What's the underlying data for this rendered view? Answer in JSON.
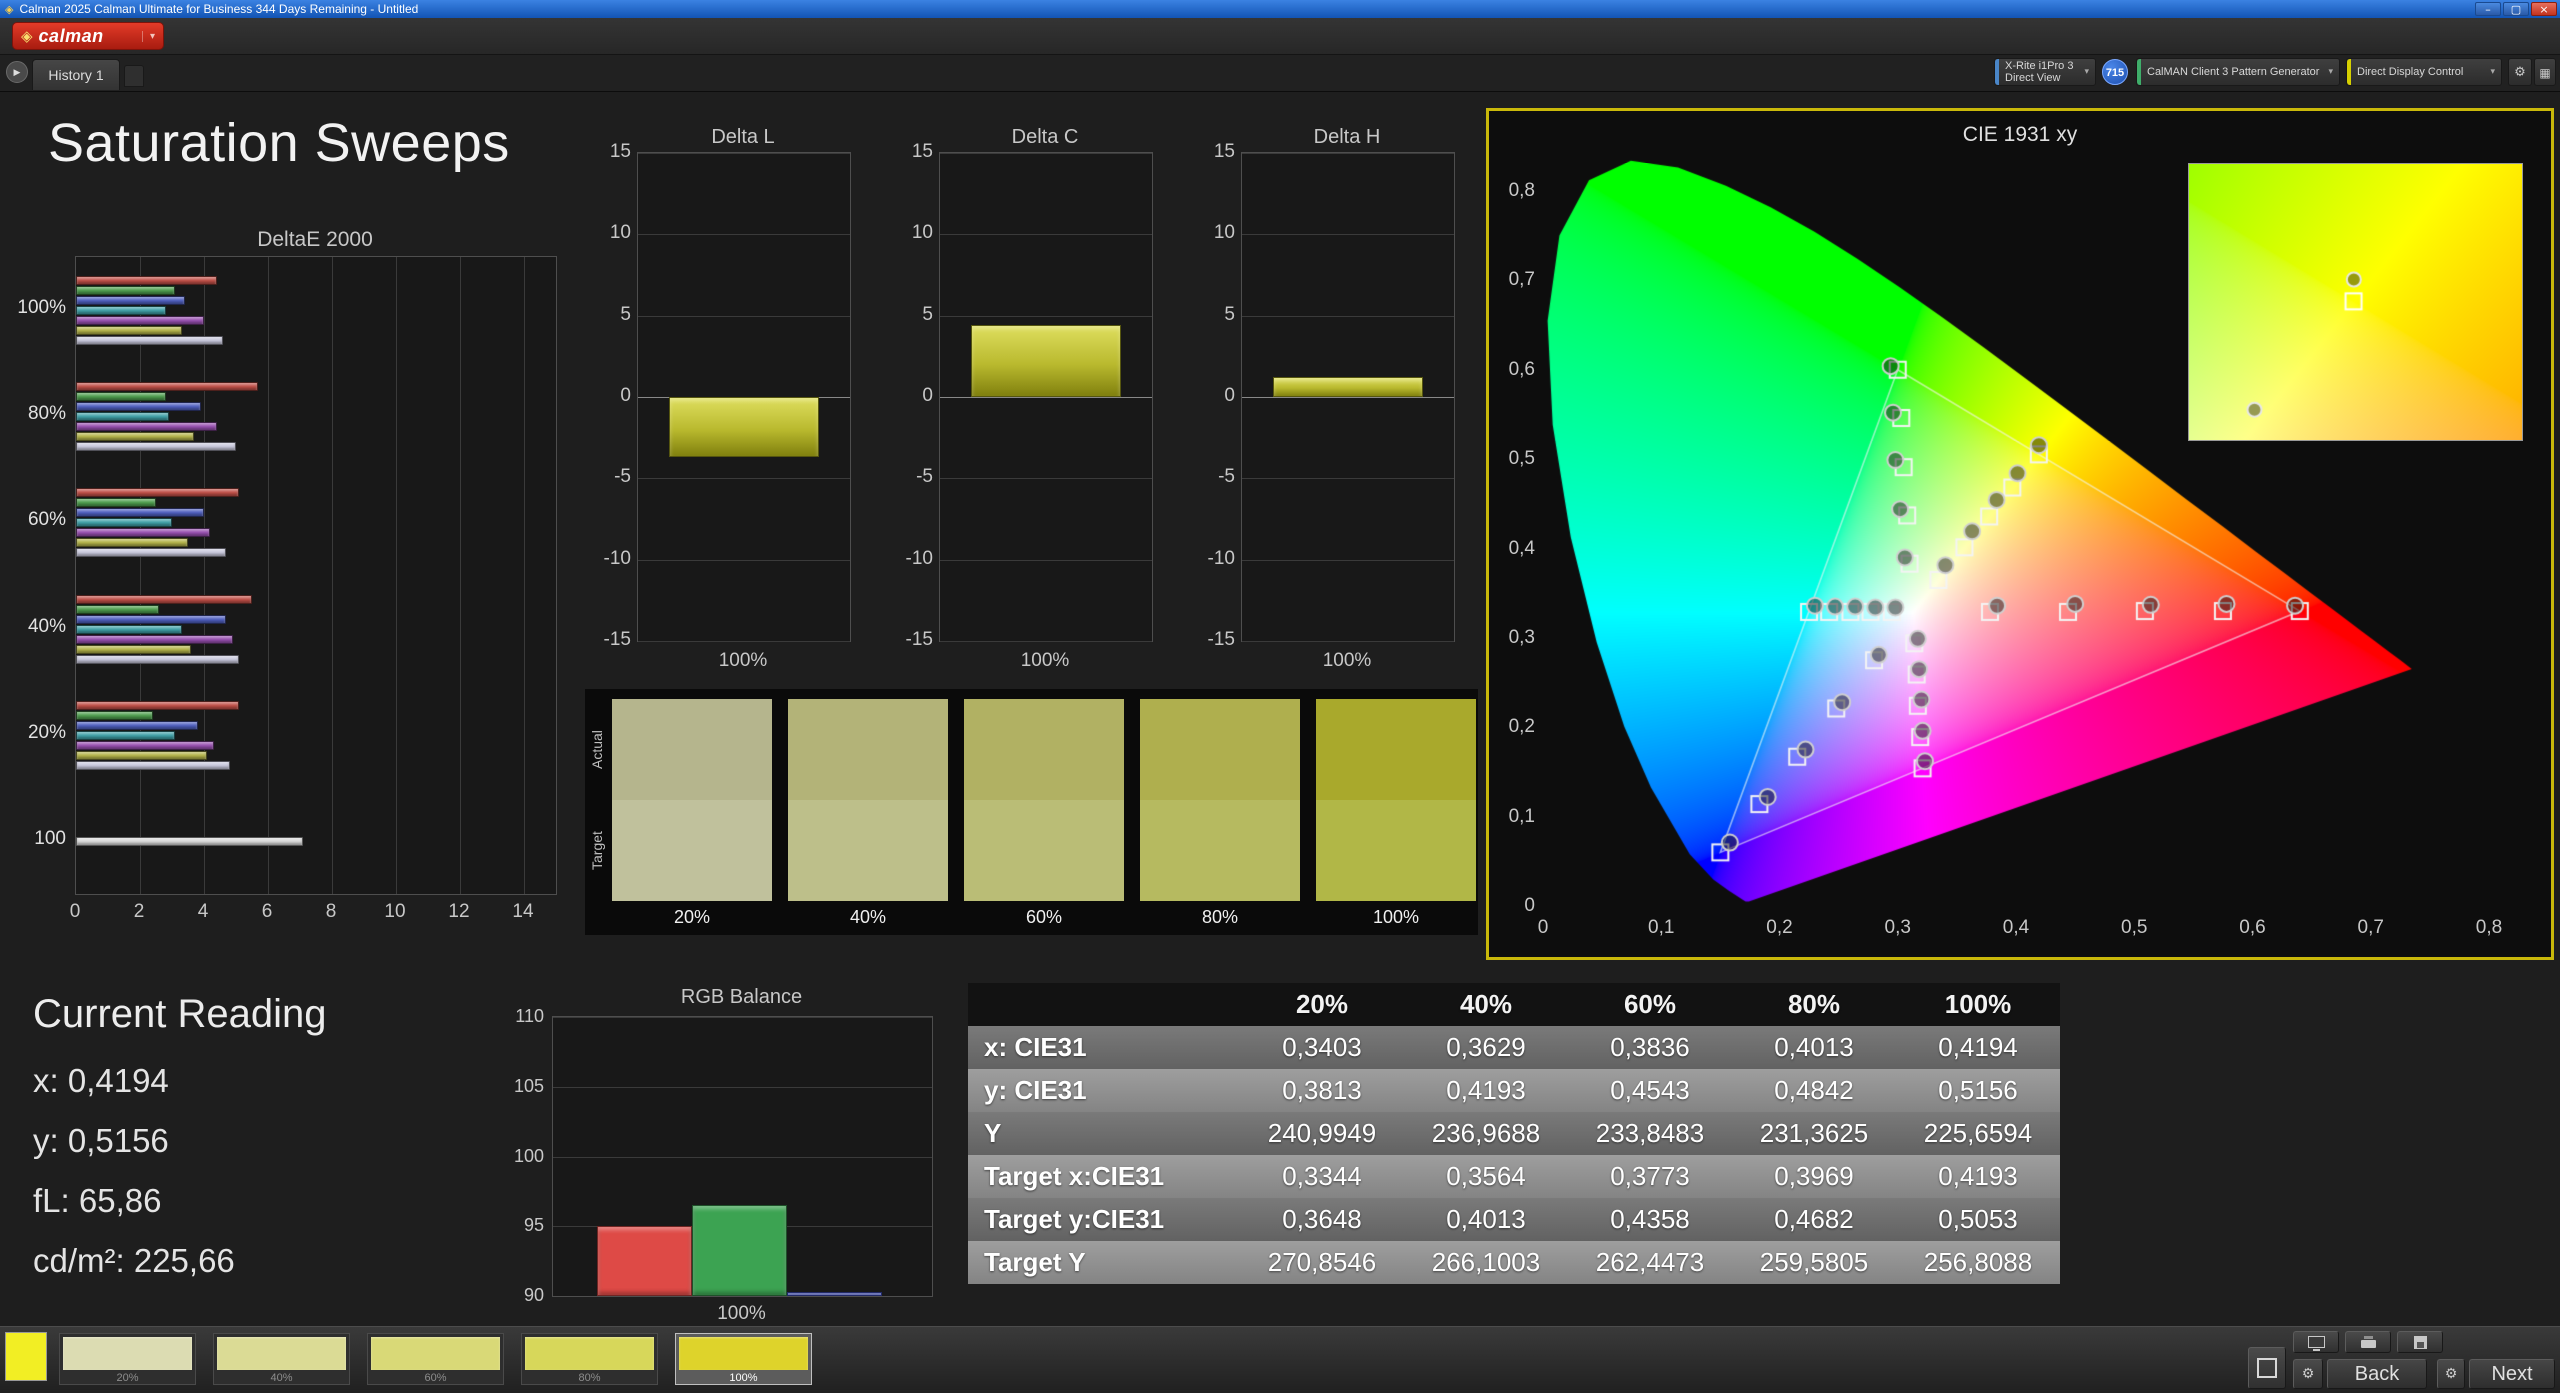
{
  "window": {
    "title": "Calman 2025 Calman Ultimate for Business 344 Days Remaining  - Untitled"
  },
  "icons": {
    "logo": "◈",
    "dropdown": "▾",
    "play": "▶",
    "gear": "⚙",
    "grid": "▦",
    "minimize": "–",
    "maximize": "▢",
    "close": "×"
  },
  "menubar": {
    "logo_text": "calman"
  },
  "toolbar": {
    "history_tab": "History 1",
    "meter_line1": "X-Rite i1Pro 3",
    "meter_line2": "Direct View",
    "meter_indicator": "#4a86c8",
    "badge": "715",
    "source_label": "CalMAN Client 3 Pattern Generator",
    "source_indicator": "#3fae6a",
    "display_label": "Direct Display Control",
    "display_indicator": "#d6d000"
  },
  "page_title": "Saturation Sweeps",
  "deltae_chart": {
    "title": "DeltaE 2000",
    "xmax": 15,
    "xticks": [
      0,
      2,
      4,
      6,
      8,
      10,
      12,
      14
    ],
    "bar_colors": [
      "#c05048",
      "#4e9e4e",
      "#5060c0",
      "#3fa0a8",
      "#9850b0",
      "#b4b44a",
      "#c8c8dc"
    ],
    "groups": [
      {
        "label": "100%",
        "values": [
          4.4,
          3.1,
          3.4,
          2.8,
          4.0,
          3.3,
          4.6
        ]
      },
      {
        "label": "80%",
        "values": [
          5.7,
          2.8,
          3.9,
          2.9,
          4.4,
          3.7,
          5.0
        ]
      },
      {
        "label": "60%",
        "values": [
          5.1,
          2.5,
          4.0,
          3.0,
          4.2,
          3.5,
          4.7
        ]
      },
      {
        "label": "40%",
        "values": [
          5.5,
          2.6,
          4.7,
          3.3,
          4.9,
          3.6,
          5.1
        ]
      },
      {
        "label": "20%",
        "values": [
          5.1,
          2.4,
          3.8,
          3.1,
          4.3,
          4.1,
          4.8
        ]
      },
      {
        "label": "100",
        "values": [
          7.1
        ],
        "colors": [
          "#d8d8d8"
        ]
      }
    ]
  },
  "delta_charts": {
    "ymax": 15,
    "yticks": [
      15,
      10,
      5,
      0,
      -5,
      -10,
      -15
    ],
    "xlabel": "100%",
    "bar_color": "#b9b92e",
    "charts": [
      {
        "title": "Delta L",
        "value": -3.7
      },
      {
        "title": "Delta C",
        "value": 4.4
      },
      {
        "title": "Delta H",
        "value": 1.2
      }
    ]
  },
  "swatch_grid": {
    "row_labels": [
      "Actual",
      "Target"
    ],
    "columns": [
      "20%",
      "40%",
      "60%",
      "80%",
      "100%"
    ],
    "actual_colors": [
      "#b5b58d",
      "#b3b378",
      "#b1b163",
      "#afaf4e",
      "#a9a92c"
    ],
    "target_colors": [
      "#c0c19c",
      "#bdbf8a",
      "#babd76",
      "#b6ba60",
      "#b1b747"
    ]
  },
  "cie": {
    "title": "CIE 1931 xy",
    "border_color": "#c9b80a",
    "xticks": [
      "0",
      "0,1",
      "0,2",
      "0,3",
      "0,4",
      "0,5",
      "0,6",
      "0,7",
      "0,8"
    ],
    "yticks": [
      "0",
      "0,1",
      "0,2",
      "0,3",
      "0,4",
      "0,5",
      "0,6",
      "0,7",
      "0,8"
    ],
    "gamut": [
      [
        0.64,
        0.33
      ],
      [
        0.3,
        0.6
      ],
      [
        0.15,
        0.06
      ]
    ],
    "squares": [
      [
        0.378,
        0.329
      ],
      [
        0.444,
        0.329
      ],
      [
        0.509,
        0.33
      ],
      [
        0.575,
        0.33
      ],
      [
        0.64,
        0.33
      ],
      [
        0.31,
        0.383
      ],
      [
        0.308,
        0.437
      ],
      [
        0.305,
        0.491
      ],
      [
        0.303,
        0.546
      ],
      [
        0.3,
        0.6
      ],
      [
        0.28,
        0.275
      ],
      [
        0.248,
        0.221
      ],
      [
        0.215,
        0.167
      ],
      [
        0.183,
        0.114
      ],
      [
        0.15,
        0.06
      ],
      [
        0.295,
        0.329
      ],
      [
        0.277,
        0.329
      ],
      [
        0.26,
        0.329
      ],
      [
        0.242,
        0.329
      ],
      [
        0.225,
        0.329
      ],
      [
        0.314,
        0.294
      ],
      [
        0.316,
        0.259
      ],
      [
        0.317,
        0.224
      ],
      [
        0.319,
        0.189
      ],
      [
        0.321,
        0.154
      ],
      [
        0.3344,
        0.3648
      ],
      [
        0.3564,
        0.4013
      ],
      [
        0.3773,
        0.4358
      ],
      [
        0.3969,
        0.4682
      ],
      [
        0.4193,
        0.5053
      ]
    ],
    "circles": [
      [
        0.384,
        0.336
      ],
      [
        0.45,
        0.338
      ],
      [
        0.514,
        0.337
      ],
      [
        0.578,
        0.338
      ],
      [
        0.636,
        0.336
      ],
      [
        0.306,
        0.39
      ],
      [
        0.302,
        0.444
      ],
      [
        0.298,
        0.499
      ],
      [
        0.296,
        0.552
      ],
      [
        0.294,
        0.604
      ],
      [
        0.284,
        0.281
      ],
      [
        0.253,
        0.228
      ],
      [
        0.222,
        0.175
      ],
      [
        0.19,
        0.122
      ],
      [
        0.158,
        0.071
      ],
      [
        0.298,
        0.334
      ],
      [
        0.281,
        0.334
      ],
      [
        0.264,
        0.335
      ],
      [
        0.247,
        0.335
      ],
      [
        0.23,
        0.336
      ],
      [
        0.317,
        0.299
      ],
      [
        0.318,
        0.265
      ],
      [
        0.32,
        0.231
      ],
      [
        0.321,
        0.196
      ],
      [
        0.323,
        0.162
      ],
      [
        0.3403,
        0.3813
      ],
      [
        0.3629,
        0.4193
      ],
      [
        0.3836,
        0.4543
      ],
      [
        0.4013,
        0.4842
      ],
      [
        0.4194,
        0.5156
      ]
    ],
    "inset": {
      "x0": 0.36,
      "x1": 0.48,
      "y0": 0.44,
      "y1": 0.57,
      "squares": [
        [
          0.4193,
          0.5053
        ]
      ],
      "circles": [
        [
          0.4194,
          0.5156
        ],
        [
          0.3836,
          0.4543
        ]
      ]
    }
  },
  "current_reading": {
    "title": "Current Reading",
    "lines": [
      "x: 0,4194",
      "y: 0,5156",
      "fL: 65,86",
      "cd/m²: 225,66"
    ]
  },
  "rgb_balance": {
    "title": "RGB Balance",
    "ymin": 90,
    "ymax": 110,
    "yticks": [
      110,
      105,
      100,
      95,
      90
    ],
    "xlabel": "100%",
    "bars": [
      {
        "name": "red",
        "color": "#de4a46",
        "value": 95.0
      },
      {
        "name": "green",
        "color": "#3ca352",
        "value": 96.5
      },
      {
        "name": "blue",
        "color": "#4353cc",
        "value": 90.3
      }
    ]
  },
  "table": {
    "columns": [
      "20%",
      "40%",
      "60%",
      "80%",
      "100%"
    ],
    "rows": [
      {
        "label": "x: CIE31",
        "values": [
          "0,3403",
          "0,3629",
          "0,3836",
          "0,4013",
          "0,4194"
        ]
      },
      {
        "label": "y: CIE31",
        "values": [
          "0,3813",
          "0,4193",
          "0,4543",
          "0,4842",
          "0,5156"
        ]
      },
      {
        "label": "Y",
        "values": [
          "240,9949",
          "236,9688",
          "233,8483",
          "231,3625",
          "225,6594"
        ]
      },
      {
        "label": "Target x:CIE31",
        "values": [
          "0,3344",
          "0,3564",
          "0,3773",
          "0,3969",
          "0,4193"
        ]
      },
      {
        "label": "Target y:CIE31",
        "values": [
          "0,3648",
          "0,4013",
          "0,4358",
          "0,4682",
          "0,5053"
        ]
      },
      {
        "label": "Target Y",
        "values": [
          "270,8546",
          "266,1003",
          "262,4473",
          "259,5805",
          "256,8088"
        ]
      }
    ]
  },
  "bottom_bar": {
    "current_patch_color": "#f2ee24",
    "swatches": [
      {
        "label": "20%",
        "color": "#dcdcb2",
        "selected": false
      },
      {
        "label": "40%",
        "color": "#dbdb95",
        "selected": false
      },
      {
        "label": "60%",
        "color": "#d9d977",
        "selected": false
      },
      {
        "label": "80%",
        "color": "#d7d75a",
        "selected": false
      },
      {
        "label": "100%",
        "color": "#ded32b",
        "selected": true
      }
    ],
    "back_label": "Back",
    "next_label": "Next"
  }
}
